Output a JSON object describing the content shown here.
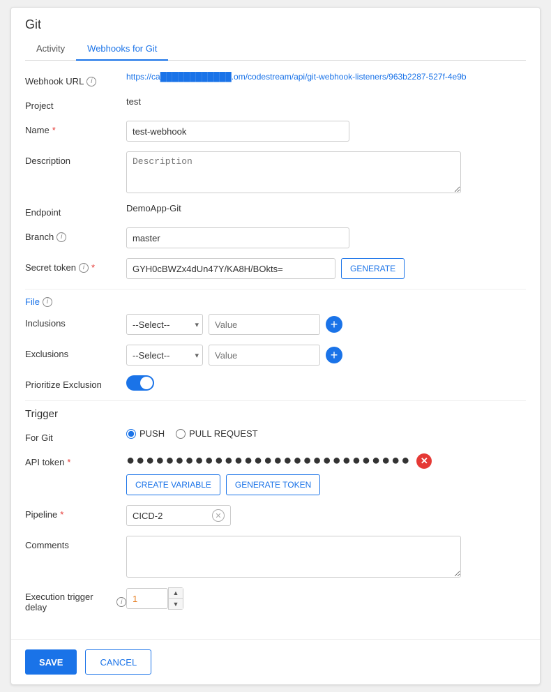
{
  "app": {
    "title": "Git"
  },
  "tabs": [
    {
      "id": "activity",
      "label": "Activity",
      "active": false
    },
    {
      "id": "webhooks",
      "label": "Webhooks for Git",
      "active": true
    }
  ],
  "form": {
    "webhook_url_label": "Webhook URL",
    "webhook_url_value": "https://ca████████████.om/codestream/api/git-webhook-listeners/963b2287-527f-4e9b",
    "project_label": "Project",
    "project_value": "test",
    "name_label": "Name",
    "name_required": "*",
    "name_value": "test-webhook",
    "description_label": "Description",
    "description_placeholder": "Description",
    "endpoint_label": "Endpoint",
    "endpoint_value": "DemoApp-Git",
    "branch_label": "Branch",
    "branch_value": "master",
    "secret_token_label": "Secret token",
    "secret_token_required": "*",
    "secret_token_value": "GYH0cBWZx4dUn47Y/KA8H/BOkts=",
    "generate_label": "GENERATE",
    "file_section_label": "File",
    "inclusions_label": "Inclusions",
    "exclusions_label": "Exclusions",
    "select_placeholder": "--Select--",
    "value_placeholder": "Value",
    "prioritize_label": "Prioritize Exclusion",
    "trigger_title": "Trigger",
    "for_git_label": "For Git",
    "push_label": "PUSH",
    "pull_request_label": "PULL REQUEST",
    "api_token_label": "API token",
    "api_token_required": "*",
    "api_token_dots": "●●●●●●●●●●●●●●●●●●●●●●●●●●●●●",
    "create_variable_label": "CREATE VARIABLE",
    "generate_token_label": "GENERATE TOKEN",
    "pipeline_label": "Pipeline",
    "pipeline_required": "*",
    "pipeline_value": "CICD-2",
    "comments_label": "Comments",
    "execution_delay_label": "Execution trigger delay",
    "execution_delay_value": "1",
    "save_label": "SAVE",
    "cancel_label": "CANCEL"
  },
  "colors": {
    "accent": "#1a73e8",
    "required": "#e53935",
    "toggle_on": "#1a73e8",
    "delay_value": "#e67e22"
  }
}
